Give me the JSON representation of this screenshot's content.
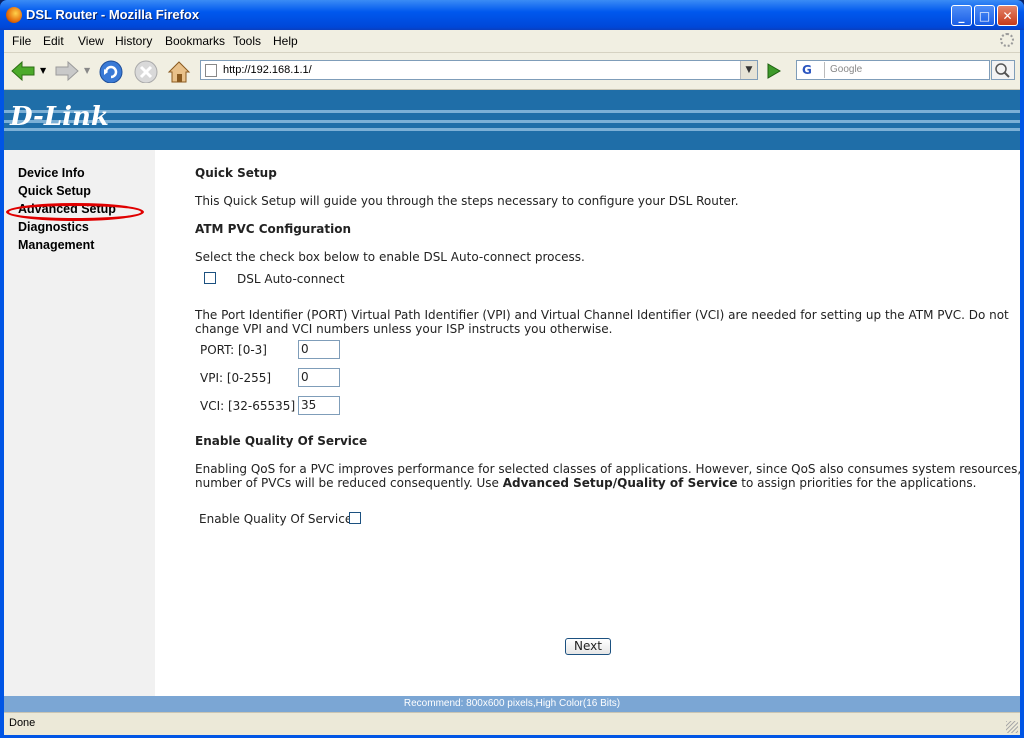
{
  "window": {
    "title": "DSL Router - Mozilla Firefox"
  },
  "menu": [
    "File",
    "Edit",
    "View",
    "History",
    "Bookmarks",
    "Tools",
    "Help"
  ],
  "navbar": {
    "url": "http://192.168.1.1/",
    "search_placeholder": "Google",
    "search_engine": "G"
  },
  "banner": {
    "logo": "D-Link"
  },
  "sidebar": {
    "items": [
      "Device Info",
      "Quick Setup",
      "Advanced Setup",
      "Diagnostics",
      "Management"
    ],
    "highlighted": "Advanced Setup"
  },
  "main": {
    "title": "Quick Setup",
    "intro": "This Quick Setup will guide you through the steps necessary to configure your DSL Router.",
    "atm_heading": "ATM PVC Configuration",
    "atm_instruction": "Select the check box below to enable DSL Auto-connect process.",
    "autoconnect_label": "DSL Auto-connect",
    "autoconnect_checked": false,
    "vpi_text_line1": "The Port Identifier (PORT) Virtual Path Identifier (VPI) and Virtual Channel Identifier (VCI) are needed for setting up the ATM PVC. Do not",
    "vpi_text_line2": "change VPI and VCI numbers unless your ISP instructs you otherwise.",
    "fields": [
      {
        "label": "PORT: [0-3]",
        "value": "0"
      },
      {
        "label": "VPI: [0-255]",
        "value": "0"
      },
      {
        "label": "VCI: [32-65535]",
        "value": "35"
      }
    ],
    "qos_heading": "Enable Quality Of Service",
    "qos_text_line1": "Enabling QoS for a PVC improves performance for selected classes of applications. However, since QoS also consumes system resources, the",
    "qos_text_line2_a": "number of PVCs will be reduced consequently. Use ",
    "qos_text_line2_bold": "Advanced Setup/Quality of Service",
    "qos_text_line2_b": " to assign priorities for the applications.",
    "qos_label": "Enable Quality Of Service",
    "qos_checked": false,
    "next_button": "Next"
  },
  "footer": "Recommend: 800x600 pixels,High Color(16 Bits)",
  "status": "Done"
}
